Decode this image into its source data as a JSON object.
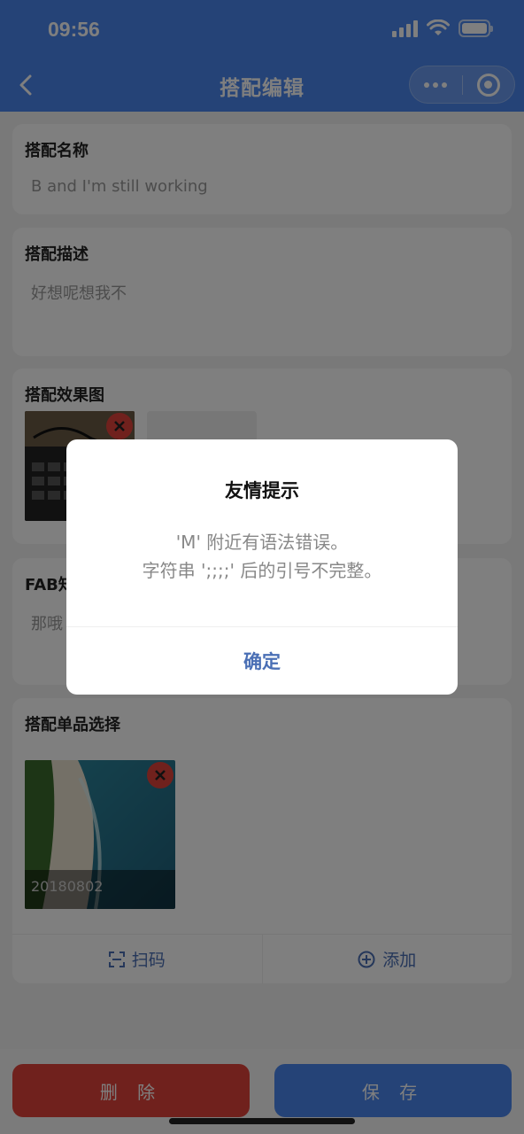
{
  "status_bar": {
    "time": "09:56"
  },
  "nav": {
    "title": "搭配编辑"
  },
  "fields": {
    "name": {
      "label": "搭配名称",
      "value": "B and I'm still working"
    },
    "desc": {
      "label": "搭配描述",
      "value": "好想呢想我不"
    },
    "effect": {
      "label": "搭配效果图"
    },
    "fab": {
      "label": "FAB知",
      "value": "那哦"
    },
    "items": {
      "label": "搭配单品选择",
      "item_code": "20180802"
    }
  },
  "items_actions": {
    "scan": "扫码",
    "add": "添加"
  },
  "bottom": {
    "delete": "删 除",
    "save": "保 存"
  },
  "dialog": {
    "title": "友情提示",
    "line1": "'M' 附近有语法错误。",
    "line2": "字符串 ';;;;' 后的引号不完整。",
    "confirm": "确定"
  },
  "colors": {
    "primary": "#4a86ee",
    "danger": "#e0433a",
    "link": "#4a6fb5"
  },
  "icons": [
    "back-icon",
    "more-icon",
    "close-circle-icon",
    "delete-badge-icon",
    "scan-icon",
    "add-circle-icon"
  ]
}
